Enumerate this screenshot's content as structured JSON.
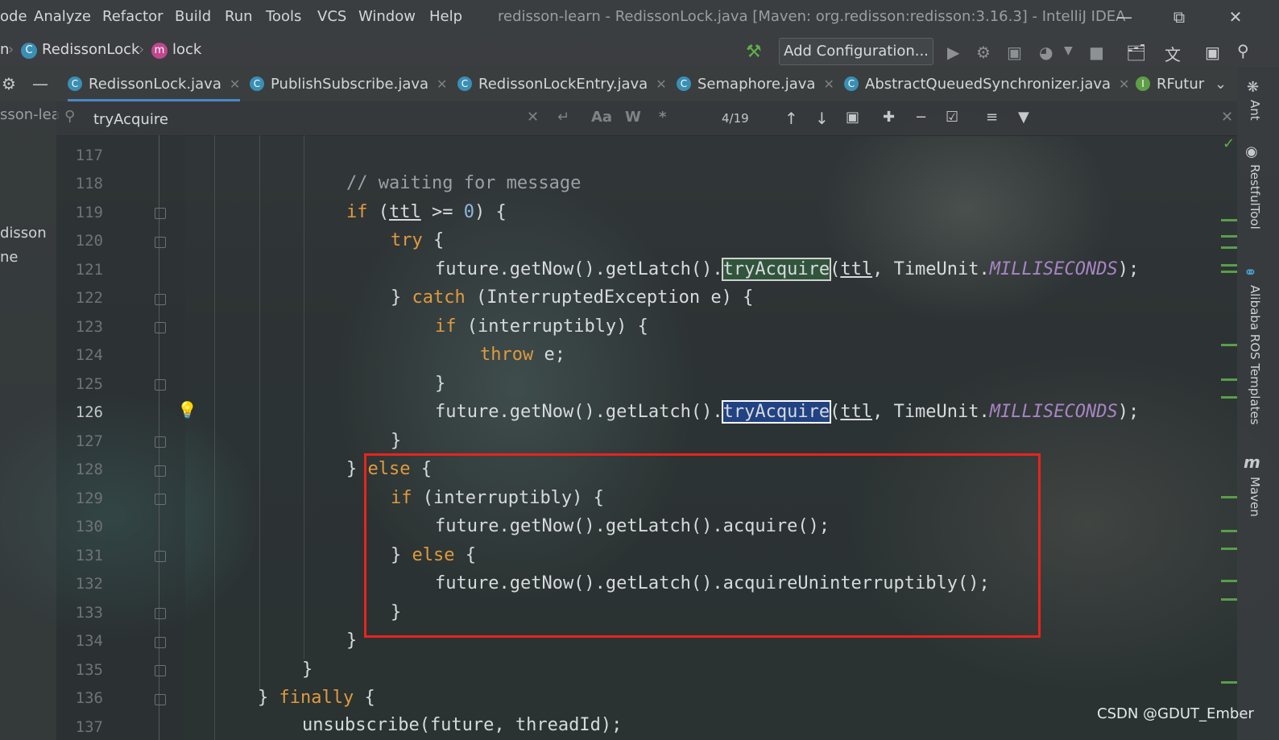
{
  "window": {
    "title": "redisson-learn - RedissonLock.java [Maven: org.redisson:redisson:3.16.3] - IntelliJ IDEA",
    "controls": [
      "minimize",
      "restore",
      "close"
    ]
  },
  "menu": {
    "items": [
      {
        "label": "ode"
      },
      {
        "label": "Analyze"
      },
      {
        "label": "Refactor"
      },
      {
        "label": "Build"
      },
      {
        "label": "Run"
      },
      {
        "label": "Tools"
      },
      {
        "label": "VCS"
      },
      {
        "label": "Window"
      },
      {
        "label": "Help"
      }
    ]
  },
  "navbar": {
    "crumbs": [
      {
        "label": "n",
        "icon": ""
      },
      {
        "label": "RedissonLock",
        "icon": "class-icon"
      },
      {
        "label": "lock",
        "icon": "method-icon"
      }
    ],
    "add_configuration": "Add Configuration..."
  },
  "tabs": [
    {
      "label": "RedissonLock.java",
      "active": true
    },
    {
      "label": "PublishSubscribe.java",
      "active": false
    },
    {
      "label": "RedissonLockEntry.java",
      "active": false
    },
    {
      "label": "Semaphore.java",
      "active": false
    },
    {
      "label": "AbstractQueuedSynchronizer.java",
      "active": false
    },
    {
      "label": "RFutur",
      "active": false
    }
  ],
  "search": {
    "value": "tryAcquire",
    "match_case": "Aa",
    "words": "W",
    "regex": "*",
    "count": "4/19"
  },
  "project_panel": {
    "root": "sson-lea",
    "items": [
      "disson",
      "ne"
    ]
  },
  "editor": {
    "current_line": 126,
    "lines": [
      {
        "n": "117"
      },
      {
        "n": "118"
      },
      {
        "n": "119"
      },
      {
        "n": "120"
      },
      {
        "n": "121"
      },
      {
        "n": "122"
      },
      {
        "n": "123"
      },
      {
        "n": "124"
      },
      {
        "n": "125"
      },
      {
        "n": "126"
      },
      {
        "n": "127"
      },
      {
        "n": "128"
      },
      {
        "n": "129"
      },
      {
        "n": "130"
      },
      {
        "n": "131"
      },
      {
        "n": "132"
      },
      {
        "n": "133"
      },
      {
        "n": "134"
      },
      {
        "n": "135"
      },
      {
        "n": "136"
      },
      {
        "n": "137"
      }
    ],
    "code": {
      "l118_comment": "// waiting for message",
      "l119_if": "if",
      "l119_open": " (",
      "l119_ttl": "ttl",
      "l119_ge": " >= ",
      "l119_zero": "0",
      "l119_close": ") {",
      "l120_try": "try",
      "l120_brace": " {",
      "l121_pre": "future.getNow().getLatch().",
      "l121_match": "tryAcquire",
      "l121_paren": "(",
      "l121_ttl": "ttl",
      "l121_comma": ", TimeUnit.",
      "l121_const": "MILLISECONDS",
      "l121_end": ");",
      "l122_close": "} ",
      "l122_catch": "catch",
      "l122_rest": " (InterruptedException e) {",
      "l123_if": "if",
      "l123_rest": " (interruptibly) {",
      "l124_throw": "throw",
      "l124_rest": " e;",
      "l125_close": "}",
      "l126_pre": "future.getNow().getLatch().",
      "l126_match": "tryAcquire",
      "l126_paren": "(",
      "l126_ttl": "ttl",
      "l126_comma": ", TimeUnit.",
      "l126_const": "MILLISECONDS",
      "l126_end": ");",
      "l127_close": "}",
      "l128_close": "} ",
      "l128_else": "else",
      "l128_brace": " {",
      "l129_if": "if",
      "l129_rest": " (interruptibly) {",
      "l130_code": "future.getNow().getLatch().acquire();",
      "l131_close": "} ",
      "l131_else": "else",
      "l131_brace": " {",
      "l132_code": "future.getNow().getLatch().acquireUninterruptibly();",
      "l133_close": "}",
      "l134_close": "}",
      "l135_close": "}",
      "l136_close": "} ",
      "l136_finally": "finally",
      "l136_brace": " {",
      "l137_code": "unsubscribe(future, threadId);"
    }
  },
  "right_tools": [
    "Ant",
    "RestfulTool",
    "Alibaba ROS Templates",
    "Maven"
  ],
  "watermark": "CSDN @GDUT_Ember"
}
